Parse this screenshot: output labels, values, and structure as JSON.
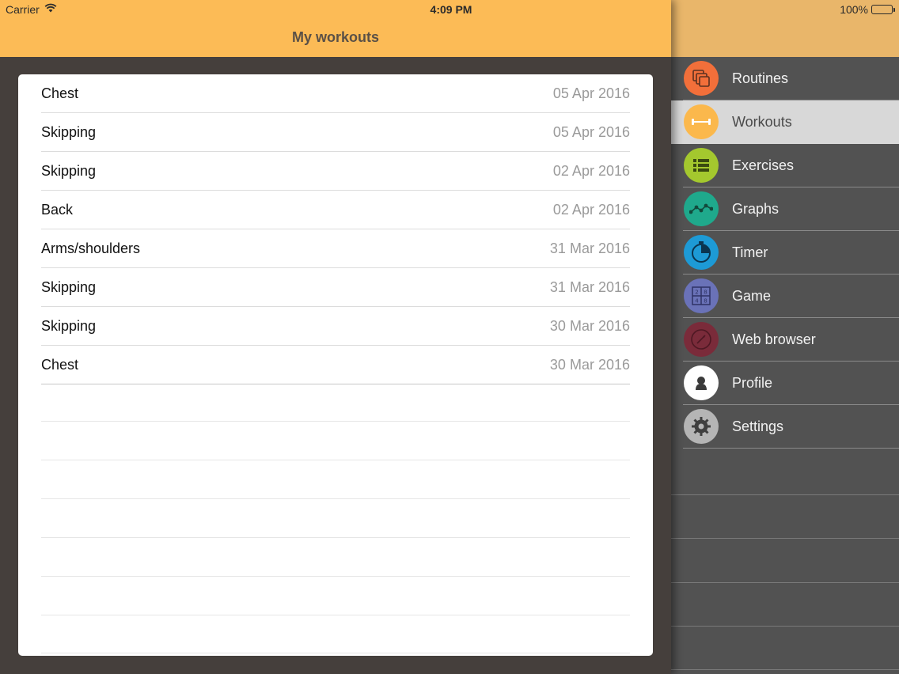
{
  "status_bar": {
    "carrier": "Carrier",
    "time": "4:09 PM",
    "battery": "100%"
  },
  "navbar": {
    "title": "My workouts"
  },
  "workouts": [
    {
      "name": "Chest",
      "date": "05 Apr 2016"
    },
    {
      "name": "Skipping",
      "date": "05 Apr 2016"
    },
    {
      "name": "Skipping",
      "date": "02 Apr 2016"
    },
    {
      "name": "Back",
      "date": "02 Apr 2016"
    },
    {
      "name": "Arms/shoulders",
      "date": "31 Mar 2016"
    },
    {
      "name": "Skipping",
      "date": "31 Mar 2016"
    },
    {
      "name": "Skipping",
      "date": "30 Mar 2016"
    },
    {
      "name": "Chest",
      "date": "30 Mar 2016"
    }
  ],
  "menu": {
    "items": [
      {
        "label": "Routines",
        "icon": "routines-icon",
        "color": "#f26f3a",
        "active": false
      },
      {
        "label": "Workouts",
        "icon": "dumbbell-icon",
        "color": "#fbb84c",
        "active": true
      },
      {
        "label": "Exercises",
        "icon": "list-icon",
        "color": "#a4c82e",
        "active": false
      },
      {
        "label": "Graphs",
        "icon": "graph-icon",
        "color": "#1fa98c",
        "active": false
      },
      {
        "label": "Timer",
        "icon": "stopwatch-icon",
        "color": "#1d9ad6",
        "active": false
      },
      {
        "label": "Game",
        "icon": "game-grid-icon",
        "color": "#6a72b8",
        "active": false
      },
      {
        "label": "Web browser",
        "icon": "compass-icon",
        "color": "#7a2b3a",
        "active": false
      },
      {
        "label": "Profile",
        "icon": "profile-icon",
        "color": "#ffffff",
        "active": false
      },
      {
        "label": "Settings",
        "icon": "gear-icon",
        "color": "#b5b5b5",
        "active": false
      }
    ]
  },
  "colors": {
    "accent": "#fcbb56",
    "menu_background": "#525252",
    "main_background": "#453f3c"
  }
}
